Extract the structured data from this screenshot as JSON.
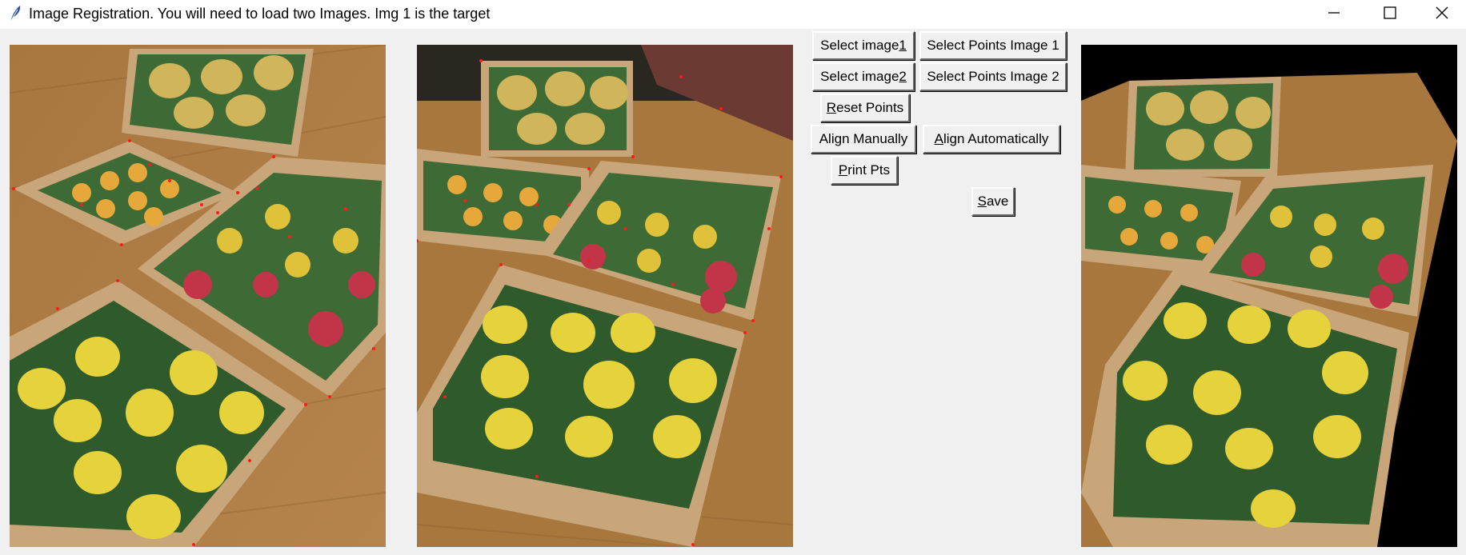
{
  "window": {
    "title": "Image Registration. You will need to load two Images. Img 1 is the target",
    "minimize_glyph": "minimize-icon",
    "maximize_glyph": "maximize-icon",
    "close_glyph": "close-icon"
  },
  "buttons": {
    "select_image_1": {
      "pre": "Select image ",
      "ul": "1",
      "post": ""
    },
    "select_points_image_1": {
      "pre": "Select Points Image 1",
      "ul": "",
      "post": ""
    },
    "select_image_2": {
      "pre": "Select image ",
      "ul": "2",
      "post": ""
    },
    "select_points_image_2": {
      "pre": "Select Points Image 2",
      "ul": "",
      "post": ""
    },
    "reset_points": {
      "pre": "",
      "ul": "R",
      "post": "eset Points"
    },
    "align_manually": {
      "pre": "Align Manually",
      "ul": "",
      "post": ""
    },
    "align_automatically": {
      "pre": "",
      "ul": "A",
      "post": "lign Automatically"
    },
    "print_pts": {
      "pre": "",
      "ul": "P",
      "post": "rint Pts"
    },
    "save": {
      "pre": "",
      "ul": "S",
      "post": "ave"
    }
  },
  "images": {
    "image1": "target-image-fruit-boxes",
    "image2": "source-image-fruit-boxes",
    "image3": "aligned-result-image"
  },
  "colors": {
    "keypoint": "#ff1a1a",
    "titlebar": "#ffffff",
    "background": "#f0f0f0"
  }
}
